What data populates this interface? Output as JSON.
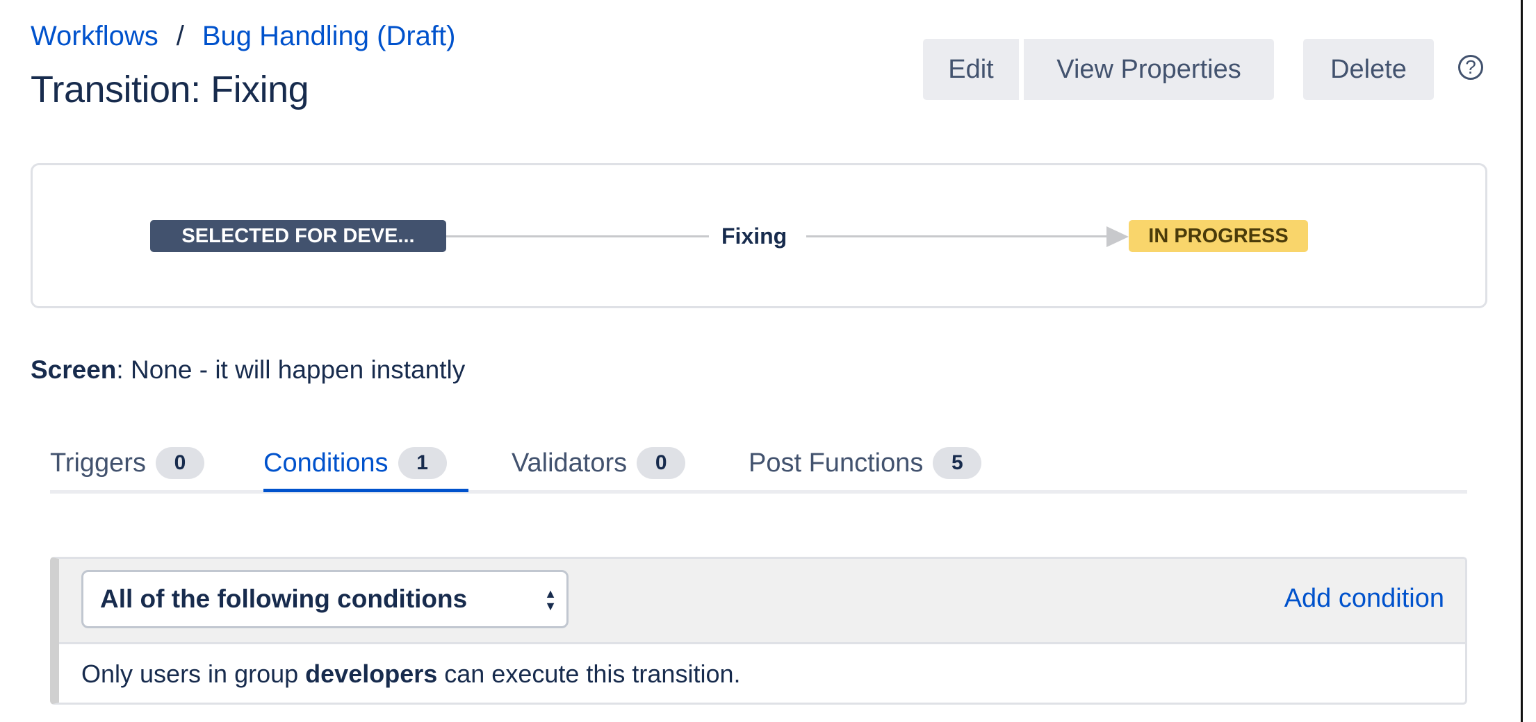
{
  "breadcrumb": {
    "items": [
      "Workflows",
      "Bug Handling (Draft)"
    ],
    "separator": "/"
  },
  "page_title": "Transition: Fixing",
  "toolbar": {
    "edit_label": "Edit",
    "view_properties_label": "View Properties",
    "delete_label": "Delete",
    "help_icon": "question-circle-icon",
    "help_glyph": "?"
  },
  "diagram": {
    "from_status": "SELECTED FOR DEVE...",
    "transition": "Fixing",
    "to_status": "IN PROGRESS",
    "colors": {
      "from": "#42526e",
      "to": "#ffd351",
      "line": "#c8c9cc"
    }
  },
  "screen": {
    "label": "Screen",
    "value": ": None - it will happen instantly"
  },
  "tabs": [
    {
      "label": "Triggers",
      "count": "0"
    },
    {
      "label": "Conditions",
      "count": "1",
      "active": true
    },
    {
      "label": "Validators",
      "count": "0"
    },
    {
      "label": "Post Functions",
      "count": "5"
    }
  ],
  "conditions": {
    "select_value": "All of the following conditions",
    "add_label": "Add condition",
    "rule": {
      "prefix": "Only users in group ",
      "group": "developers",
      "suffix": " can execute this transition."
    }
  },
  "colors": {
    "accent": "#0052cc",
    "text": "#172b4d"
  }
}
